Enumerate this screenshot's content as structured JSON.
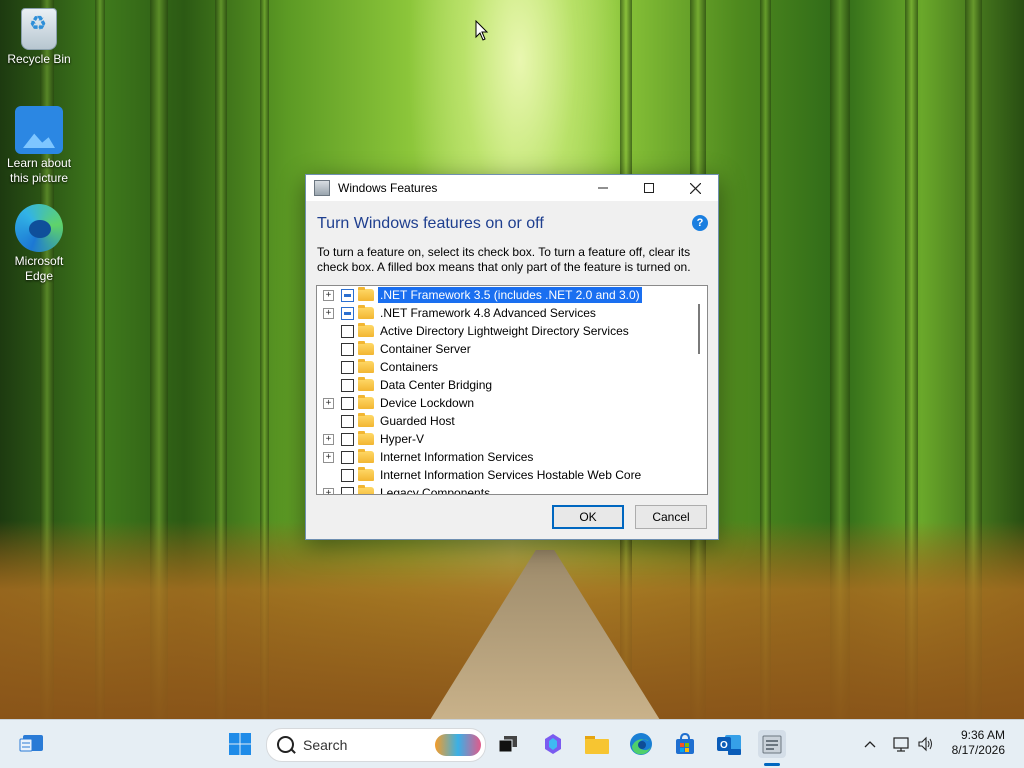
{
  "desktop": {
    "icons": [
      {
        "label": "Recycle Bin",
        "icon": "recycle-bin-icon"
      },
      {
        "label": "Learn about this picture",
        "icon": "learn-picture-icon"
      },
      {
        "label": "Microsoft Edge",
        "icon": "edge-icon"
      }
    ]
  },
  "window": {
    "title": "Windows Features",
    "heading": "Turn Windows features on or off",
    "description": "To turn a feature on, select its check box. To turn a feature off, clear its check box. A filled box means that only part of the feature is turned on.",
    "help_label": "?",
    "features": [
      {
        "label": ".NET Framework 3.5 (includes .NET 2.0 and 3.0)",
        "expandable": true,
        "state": "partial",
        "selected": true
      },
      {
        "label": ".NET Framework 4.8 Advanced Services",
        "expandable": true,
        "state": "partial",
        "selected": false
      },
      {
        "label": "Active Directory Lightweight Directory Services",
        "expandable": false,
        "state": "unchecked",
        "selected": false
      },
      {
        "label": "Container Server",
        "expandable": false,
        "state": "unchecked",
        "selected": false
      },
      {
        "label": "Containers",
        "expandable": false,
        "state": "unchecked",
        "selected": false
      },
      {
        "label": "Data Center Bridging",
        "expandable": false,
        "state": "unchecked",
        "selected": false
      },
      {
        "label": "Device Lockdown",
        "expandable": true,
        "state": "unchecked",
        "selected": false
      },
      {
        "label": "Guarded Host",
        "expandable": false,
        "state": "unchecked",
        "selected": false
      },
      {
        "label": "Hyper-V",
        "expandable": true,
        "state": "unchecked",
        "selected": false
      },
      {
        "label": "Internet Information Services",
        "expandable": true,
        "state": "unchecked",
        "selected": false
      },
      {
        "label": "Internet Information Services Hostable Web Core",
        "expandable": false,
        "state": "unchecked",
        "selected": false
      },
      {
        "label": "Legacy Components",
        "expandable": true,
        "state": "unchecked",
        "selected": false
      }
    ],
    "ok_label": "OK",
    "cancel_label": "Cancel"
  },
  "taskbar": {
    "search_placeholder": "Search",
    "pinned": [
      "widgets-icon",
      "start-icon",
      "task-view-icon",
      "copilot-icon",
      "file-explorer-icon",
      "edge-icon",
      "store-icon",
      "outlook-icon",
      "windows-features-icon"
    ],
    "active_app": "windows-features-icon",
    "tray_icons": [
      "chevron-up-icon",
      "network-icon",
      "volume-icon"
    ],
    "time": "9:36 AM",
    "date": "8/17/2026"
  },
  "colors": {
    "heading": "#1f3f8f",
    "selection": "#1a6ff0",
    "accent": "#0067c0"
  }
}
